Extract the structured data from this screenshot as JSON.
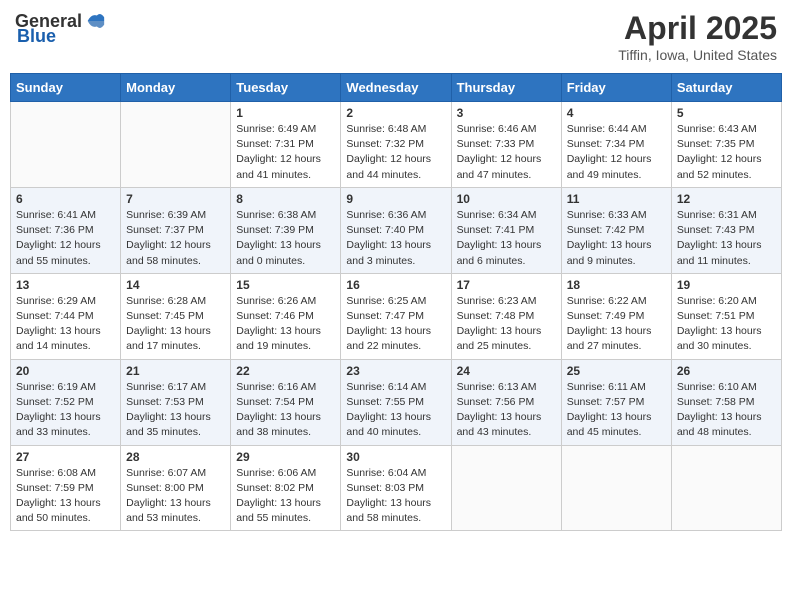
{
  "header": {
    "logo_general": "General",
    "logo_blue": "Blue",
    "title": "April 2025",
    "subtitle": "Tiffin, Iowa, United States"
  },
  "weekdays": [
    "Sunday",
    "Monday",
    "Tuesday",
    "Wednesday",
    "Thursday",
    "Friday",
    "Saturday"
  ],
  "weeks": [
    [
      {
        "day": "",
        "info": ""
      },
      {
        "day": "",
        "info": ""
      },
      {
        "day": "1",
        "info": "Sunrise: 6:49 AM\nSunset: 7:31 PM\nDaylight: 12 hours and 41 minutes."
      },
      {
        "day": "2",
        "info": "Sunrise: 6:48 AM\nSunset: 7:32 PM\nDaylight: 12 hours and 44 minutes."
      },
      {
        "day": "3",
        "info": "Sunrise: 6:46 AM\nSunset: 7:33 PM\nDaylight: 12 hours and 47 minutes."
      },
      {
        "day": "4",
        "info": "Sunrise: 6:44 AM\nSunset: 7:34 PM\nDaylight: 12 hours and 49 minutes."
      },
      {
        "day": "5",
        "info": "Sunrise: 6:43 AM\nSunset: 7:35 PM\nDaylight: 12 hours and 52 minutes."
      }
    ],
    [
      {
        "day": "6",
        "info": "Sunrise: 6:41 AM\nSunset: 7:36 PM\nDaylight: 12 hours and 55 minutes."
      },
      {
        "day": "7",
        "info": "Sunrise: 6:39 AM\nSunset: 7:37 PM\nDaylight: 12 hours and 58 minutes."
      },
      {
        "day": "8",
        "info": "Sunrise: 6:38 AM\nSunset: 7:39 PM\nDaylight: 13 hours and 0 minutes."
      },
      {
        "day": "9",
        "info": "Sunrise: 6:36 AM\nSunset: 7:40 PM\nDaylight: 13 hours and 3 minutes."
      },
      {
        "day": "10",
        "info": "Sunrise: 6:34 AM\nSunset: 7:41 PM\nDaylight: 13 hours and 6 minutes."
      },
      {
        "day": "11",
        "info": "Sunrise: 6:33 AM\nSunset: 7:42 PM\nDaylight: 13 hours and 9 minutes."
      },
      {
        "day": "12",
        "info": "Sunrise: 6:31 AM\nSunset: 7:43 PM\nDaylight: 13 hours and 11 minutes."
      }
    ],
    [
      {
        "day": "13",
        "info": "Sunrise: 6:29 AM\nSunset: 7:44 PM\nDaylight: 13 hours and 14 minutes."
      },
      {
        "day": "14",
        "info": "Sunrise: 6:28 AM\nSunset: 7:45 PM\nDaylight: 13 hours and 17 minutes."
      },
      {
        "day": "15",
        "info": "Sunrise: 6:26 AM\nSunset: 7:46 PM\nDaylight: 13 hours and 19 minutes."
      },
      {
        "day": "16",
        "info": "Sunrise: 6:25 AM\nSunset: 7:47 PM\nDaylight: 13 hours and 22 minutes."
      },
      {
        "day": "17",
        "info": "Sunrise: 6:23 AM\nSunset: 7:48 PM\nDaylight: 13 hours and 25 minutes."
      },
      {
        "day": "18",
        "info": "Sunrise: 6:22 AM\nSunset: 7:49 PM\nDaylight: 13 hours and 27 minutes."
      },
      {
        "day": "19",
        "info": "Sunrise: 6:20 AM\nSunset: 7:51 PM\nDaylight: 13 hours and 30 minutes."
      }
    ],
    [
      {
        "day": "20",
        "info": "Sunrise: 6:19 AM\nSunset: 7:52 PM\nDaylight: 13 hours and 33 minutes."
      },
      {
        "day": "21",
        "info": "Sunrise: 6:17 AM\nSunset: 7:53 PM\nDaylight: 13 hours and 35 minutes."
      },
      {
        "day": "22",
        "info": "Sunrise: 6:16 AM\nSunset: 7:54 PM\nDaylight: 13 hours and 38 minutes."
      },
      {
        "day": "23",
        "info": "Sunrise: 6:14 AM\nSunset: 7:55 PM\nDaylight: 13 hours and 40 minutes."
      },
      {
        "day": "24",
        "info": "Sunrise: 6:13 AM\nSunset: 7:56 PM\nDaylight: 13 hours and 43 minutes."
      },
      {
        "day": "25",
        "info": "Sunrise: 6:11 AM\nSunset: 7:57 PM\nDaylight: 13 hours and 45 minutes."
      },
      {
        "day": "26",
        "info": "Sunrise: 6:10 AM\nSunset: 7:58 PM\nDaylight: 13 hours and 48 minutes."
      }
    ],
    [
      {
        "day": "27",
        "info": "Sunrise: 6:08 AM\nSunset: 7:59 PM\nDaylight: 13 hours and 50 minutes."
      },
      {
        "day": "28",
        "info": "Sunrise: 6:07 AM\nSunset: 8:00 PM\nDaylight: 13 hours and 53 minutes."
      },
      {
        "day": "29",
        "info": "Sunrise: 6:06 AM\nSunset: 8:02 PM\nDaylight: 13 hours and 55 minutes."
      },
      {
        "day": "30",
        "info": "Sunrise: 6:04 AM\nSunset: 8:03 PM\nDaylight: 13 hours and 58 minutes."
      },
      {
        "day": "",
        "info": ""
      },
      {
        "day": "",
        "info": ""
      },
      {
        "day": "",
        "info": ""
      }
    ]
  ]
}
